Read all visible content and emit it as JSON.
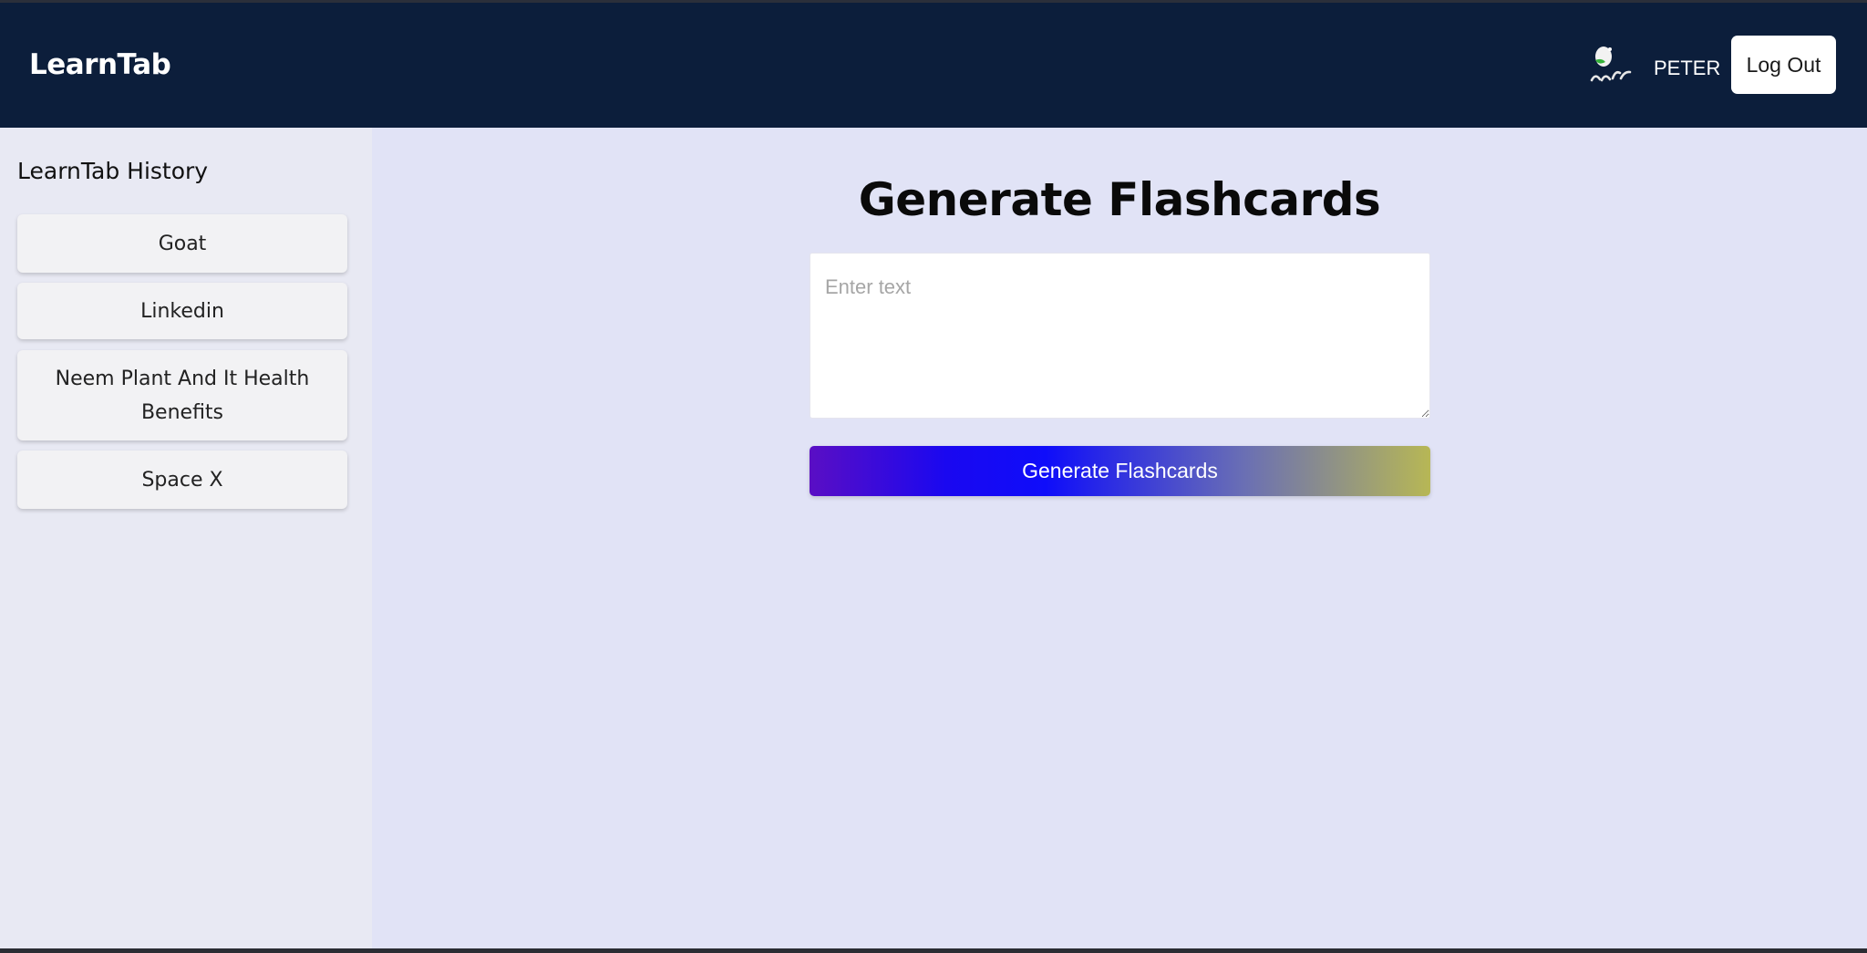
{
  "header": {
    "brand": "LearnTab",
    "username": "PETER",
    "logout_label": "Log Out",
    "avatar_icon": "avatar-icon"
  },
  "sidebar": {
    "title": "LearnTab History",
    "items": [
      {
        "label": "Goat"
      },
      {
        "label": "Linkedin"
      },
      {
        "label": "Neem Plant And It Health Benefits"
      },
      {
        "label": "Space X"
      }
    ]
  },
  "main": {
    "title": "Generate Flashcards",
    "input_placeholder": "Enter text",
    "input_value": "",
    "generate_label": "Generate Flashcards"
  },
  "colors": {
    "header_bg": "#0c1e3b",
    "page_bg": "#e1e3f6",
    "sidebar_bg": "#e8e9f3",
    "button_gradient_start": "#5a0ec4",
    "button_gradient_mid": "#0f0dfa",
    "button_gradient_end": "#b7b755"
  }
}
